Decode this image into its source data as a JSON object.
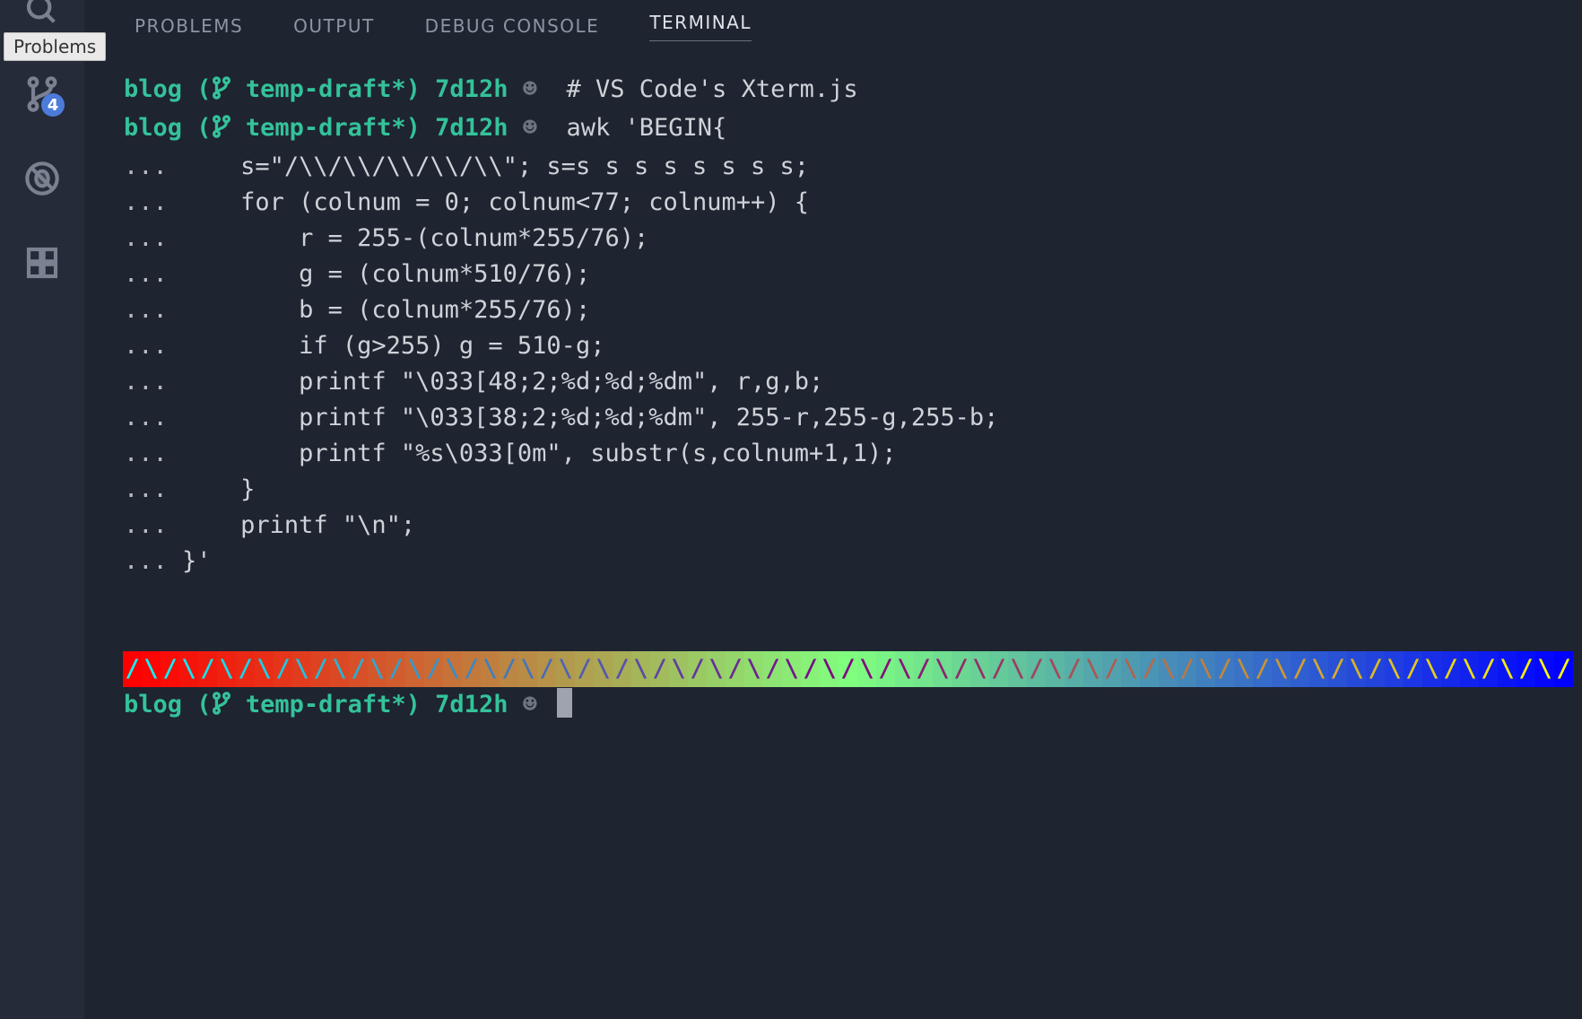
{
  "tooltip": "Problems",
  "source_control": {
    "badge": "4"
  },
  "tabs": {
    "problems": "PROBLEMS",
    "output": "OUTPUT",
    "debug_console": "DEBUG CONSOLE",
    "terminal": "TERMINAL",
    "active": "terminal"
  },
  "prompt": {
    "dir": "blog",
    "branch": "temp-draft*",
    "time": "7d12h",
    "face": "☻"
  },
  "terminal_lines": {
    "cmd1": "# VS Code's Xterm.js",
    "cmd2": "awk 'BEGIN{",
    "l1": "    s=\"/\\\\/\\\\/\\\\/\\\\/\\\\\"; s=s s s s s s s s;",
    "l2": "    for (colnum = 0; colnum<77; colnum++) {",
    "l3": "        r = 255-(colnum*255/76);",
    "l4": "        g = (colnum*510/76);",
    "l5": "        b = (colnum*255/76);",
    "l6": "        if (g>255) g = 510-g;",
    "l7": "        printf \"\\033[48;2;%d;%d;%dm\", r,g,b;",
    "l8": "        printf \"\\033[38;2;%d;%d;%dm\", 255-r,255-g,255-b;",
    "l9": "        printf \"%s\\033[0m\", substr(s,colnum+1,1);",
    "l10": "    }",
    "l11": "    printf \"\\n\";",
    "l12": "}'"
  },
  "continuation_marker": "...",
  "gradient": {
    "columns": 77,
    "pattern_start_slash": true,
    "bg_formula": "r = 255 - col*255/76 ; g = min(col*510/76, 510 - col*510/76) ; b = col*255/76",
    "fg_formula": "255 - bg"
  }
}
